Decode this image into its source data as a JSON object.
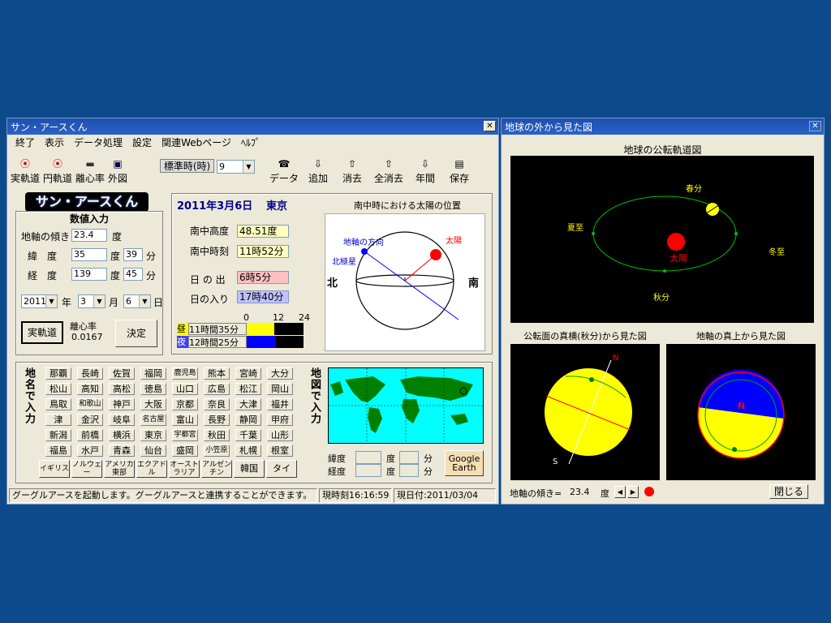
{
  "left_window": {
    "title": "サン・アースくん",
    "close_label": "✕",
    "menu": [
      "終了",
      "表示",
      "データ処理",
      "設定",
      "関連Webページ",
      "ﾍﾙﾌﾟ"
    ],
    "toolbar_left": [
      {
        "label": "実軌道",
        "icon": "⦿"
      },
      {
        "label": "円軌道",
        "icon": "⦿"
      },
      {
        "label": "離心率",
        "icon": "▬"
      },
      {
        "label": "外図",
        "icon": "▣"
      }
    ],
    "std_time_label": "標準時(時)",
    "std_time_value": "9",
    "toolbar_right": [
      {
        "label": "データ",
        "icon": "☎"
      },
      {
        "label": "追加",
        "icon": "⇩"
      },
      {
        "label": "消去",
        "icon": "⇧"
      },
      {
        "label": "全消去",
        "icon": "⇧"
      },
      {
        "label": "年間",
        "icon": "⇩"
      },
      {
        "label": "保存",
        "icon": "▤"
      }
    ],
    "logo": "サン・アースくん",
    "input": {
      "heading": "数値入力",
      "tilt_label": "地軸の傾き",
      "tilt_value": "23.4",
      "tilt_unit": "度",
      "lat_label": "緯　度",
      "lat_deg": "35",
      "lat_deg_unit": "度",
      "lat_min": "39",
      "lat_min_unit": "分",
      "lon_label": "経　度",
      "lon_deg": "139",
      "lon_deg_unit": "度",
      "lon_min": "45",
      "lon_min_unit": "分",
      "year": "2011",
      "year_unit": "年",
      "month": "3",
      "month_unit": "月",
      "day": "6",
      "day_unit": "日",
      "orbit_button": "実軌道",
      "ecc_label": "離心率",
      "ecc_value": "0.0167",
      "decide_button": "決定"
    },
    "info": {
      "date": "2011年3月6日",
      "place": "東京",
      "alt_label": "南中高度",
      "alt_value": "48.51度",
      "time_label": "南中時刻",
      "time_value": "11時52分",
      "rise_label": "日 の 出",
      "rise_value": "6時5分",
      "set_label": "日の入り",
      "set_value": "17時40分",
      "scale": [
        "0",
        "12",
        "24"
      ],
      "day_label": "昼",
      "day_value": "11時間35分",
      "day_fraction": 0.483,
      "night_label": "夜",
      "night_value": "12時間25分",
      "night_fraction": 0.517
    },
    "diagram": {
      "title": "南中時における太陽の位置",
      "axis_dir": "地軸の方向",
      "sun": "太陽",
      "polaris": "北極星",
      "north": "北",
      "south": "南"
    },
    "places": {
      "vertical_label": "地名で入力",
      "cities": [
        [
          "那覇",
          "長崎",
          "佐賀",
          "福岡",
          "鹿児島",
          "熊本",
          "宮崎",
          "大分"
        ],
        [
          "松山",
          "高知",
          "高松",
          "徳島",
          "山口",
          "広島",
          "松江",
          "岡山"
        ],
        [
          "鳥取",
          "和歌山",
          "神戸",
          "大阪",
          "京都",
          "奈良",
          "大津",
          "福井"
        ],
        [
          "津",
          "金沢",
          "岐阜",
          "名古屋",
          "富山",
          "長野",
          "静岡",
          "甲府"
        ],
        [
          "新潟",
          "前橋",
          "横浜",
          "東京",
          "宇都宮",
          "秋田",
          "千葉",
          "山形"
        ],
        [
          "福島",
          "水戸",
          "青森",
          "仙台",
          "盛岡",
          "小笠原",
          "札幌",
          "根室"
        ]
      ],
      "countries": [
        "イギリス",
        "ノルウェー",
        "アメリカ東部",
        "エクアドル",
        "オーストラリア",
        "アルゼンチン",
        "韓国",
        "タイ"
      ],
      "map_vertical_label": "地図で入力",
      "lat_label": "緯度",
      "lon_label": "経度",
      "deg_unit": "度",
      "min_unit": "分",
      "google_earth": "Google Earth"
    },
    "status": {
      "message": "グーグルアースを起動します。グーグルアースと連携することができます。",
      "now_time": "現時刻16:16:59",
      "today": "現日付:2011/03/04"
    }
  },
  "right_window": {
    "title": "地球の外から見た図",
    "close_label": "✕",
    "orbit_title": "地球の公転軌道図",
    "spring": "春分",
    "summer": "夏至",
    "winter": "冬至",
    "autumn": "秋分",
    "sun": "太陽",
    "side_title": "公転面の真横(秋分)から見た図",
    "top_title": "地軸の真上から見た図",
    "n_label": "N",
    "s_label": "S",
    "tilt_label": "地軸の傾き=",
    "tilt_value": "23.4",
    "tilt_unit": "度",
    "close_button": "閉じる"
  },
  "colors": {
    "desktop": "#0c4a8c",
    "sun": "#ff0000",
    "earth": "#ffff00",
    "orbit": "#00c000",
    "ocean": "#00ffff",
    "land": "#008000",
    "night": "#0000ff"
  }
}
